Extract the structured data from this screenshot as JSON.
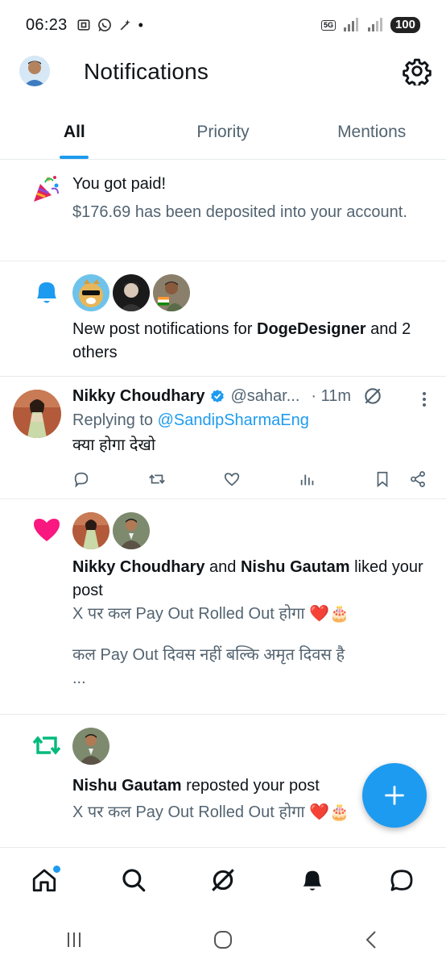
{
  "status_bar": {
    "time": "06:23",
    "network": "5G",
    "battery": "100",
    "dot": "•"
  },
  "header": {
    "title": "Notifications",
    "avatar_icon": "user-avatar",
    "settings_icon": "gear-icon"
  },
  "tabs": [
    {
      "label": "All",
      "active": true
    },
    {
      "label": "Priority",
      "active": false
    },
    {
      "label": "Mentions",
      "active": false
    }
  ],
  "notifications": {
    "payout": {
      "icon": "party-popper-icon",
      "title": "You got paid!",
      "body": "$176.69 has been deposited into your account."
    },
    "new_posts": {
      "icon": "bell-icon",
      "prefix": "New post notifications for ",
      "name": "DogeDesigner",
      "suffix": " and 2 others"
    },
    "reply": {
      "author": "Nikky Choudhary",
      "handle": "@sahar...",
      "time": "· 11m",
      "replying_prefix": "Replying to ",
      "replying_handle": "@SandipSharmaEng",
      "text": "क्या होगा देखो"
    },
    "liked": {
      "icon": "heart-icon",
      "name1": "Nikky Choudhary",
      "and": " and ",
      "name2": "Nishu Gautam",
      "action": " liked your post",
      "line1": "X पर कल Pay Out Rolled Out होगा ❤️🎂",
      "line2": "कल Pay Out दिवस नहीं बल्कि अमृत दिवस है",
      "ellipsis": "..."
    },
    "repost": {
      "icon": "repost-icon",
      "name": "Nishu Gautam",
      "action": " reposted your post",
      "line1": "X पर कल Pay Out Rolled Out होगा ❤️🎂"
    }
  },
  "colors": {
    "accent": "#1d9bf0",
    "like": "#f91880",
    "repost": "#00ba7c",
    "secondary_text": "#536471"
  }
}
